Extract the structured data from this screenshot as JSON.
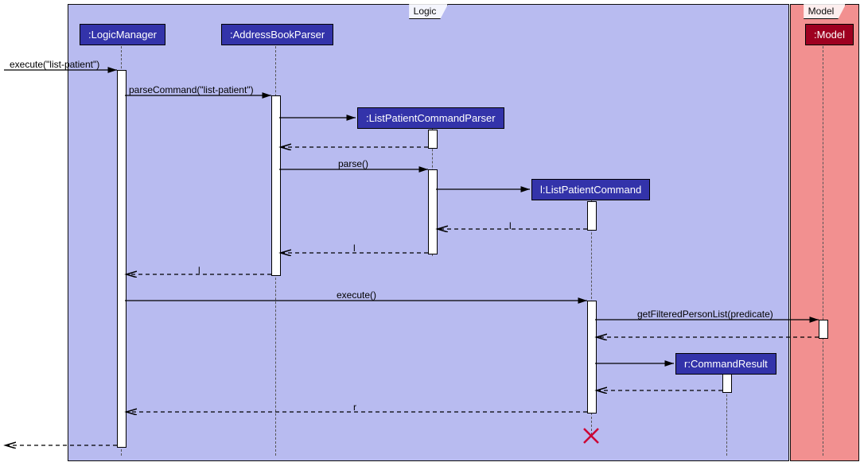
{
  "frames": {
    "logic": {
      "label": "Logic"
    },
    "model": {
      "label": "Model"
    }
  },
  "participants": {
    "logicManager": ":LogicManager",
    "addressBookParser": ":AddressBookParser",
    "listPatientCommandParser": ":ListPatientCommandParser",
    "listPatientCommand": "l:ListPatientCommand",
    "commandResult": "r:CommandResult",
    "model": ":Model"
  },
  "messages": {
    "execute": "execute(\"list-patient\")",
    "parseCommand": "parseCommand(\"list-patient\")",
    "parse": "parse()",
    "return_l1": "l",
    "return_l2": "l",
    "return_l3": "l",
    "executeCmd": "execute()",
    "getFiltered": "getFilteredPersonList(predicate)",
    "return_r": "r"
  }
}
